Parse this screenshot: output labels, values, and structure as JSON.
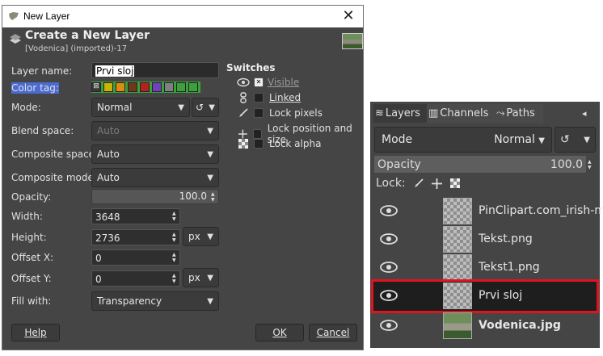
{
  "dialog": {
    "window_title": "New Layer",
    "header_title": "Create a New Layer",
    "header_subtitle": "[Vodenica] (imported)-17",
    "labels": {
      "layer_name": "Layer name:",
      "color_tag": "Color tag:",
      "mode": "Mode:",
      "blend_space": "Blend space:",
      "composite_space": "Composite space:",
      "composite_mode": "Composite mode:",
      "opacity": "Opacity:",
      "width": "Width:",
      "height": "Height:",
      "offset_x": "Offset X:",
      "offset_y": "Offset Y:",
      "fill_with": "Fill with:"
    },
    "values": {
      "layer_name": "Prvi sloj",
      "mode": "Normal",
      "blend_space": "Auto",
      "composite_space": "Auto",
      "composite_mode": "Auto",
      "opacity": "100.0",
      "width": "3648",
      "height": "2736",
      "unit_1": "px",
      "offset_x": "0",
      "offset_y": "0",
      "unit_2": "px",
      "fill_with": "Transparency"
    },
    "color_tags": [
      "#4a6bd0",
      "#3ca03c",
      "#c8b400",
      "#e08a10",
      "#6a3a1a",
      "#b82020",
      "#7040c0",
      "#808080"
    ],
    "switches": {
      "title": "Switches",
      "visible": "Visible",
      "linked": "Linked",
      "lock_pixels": "Lock pixels",
      "lock_position": "Lock position and size",
      "lock_alpha": "Lock alpha"
    },
    "buttons": {
      "help": "Help",
      "ok": "OK",
      "cancel": "Cancel"
    }
  },
  "layers_panel": {
    "tabs": {
      "layers": "Layers",
      "channels": "Channels",
      "paths": "Paths"
    },
    "mode_label": "Mode",
    "mode_value": "Normal",
    "opacity_label": "Opacity",
    "opacity_value": "100.0",
    "lock_label": "Lock:",
    "layers": [
      {
        "name": "PinClipart.com_irish-m"
      },
      {
        "name": "Tekst.png"
      },
      {
        "name": "Tekst1.png"
      },
      {
        "name": "Prvi sloj"
      },
      {
        "name": "Vodenica.jpg"
      }
    ],
    "highlight_color": "#e0141e"
  }
}
